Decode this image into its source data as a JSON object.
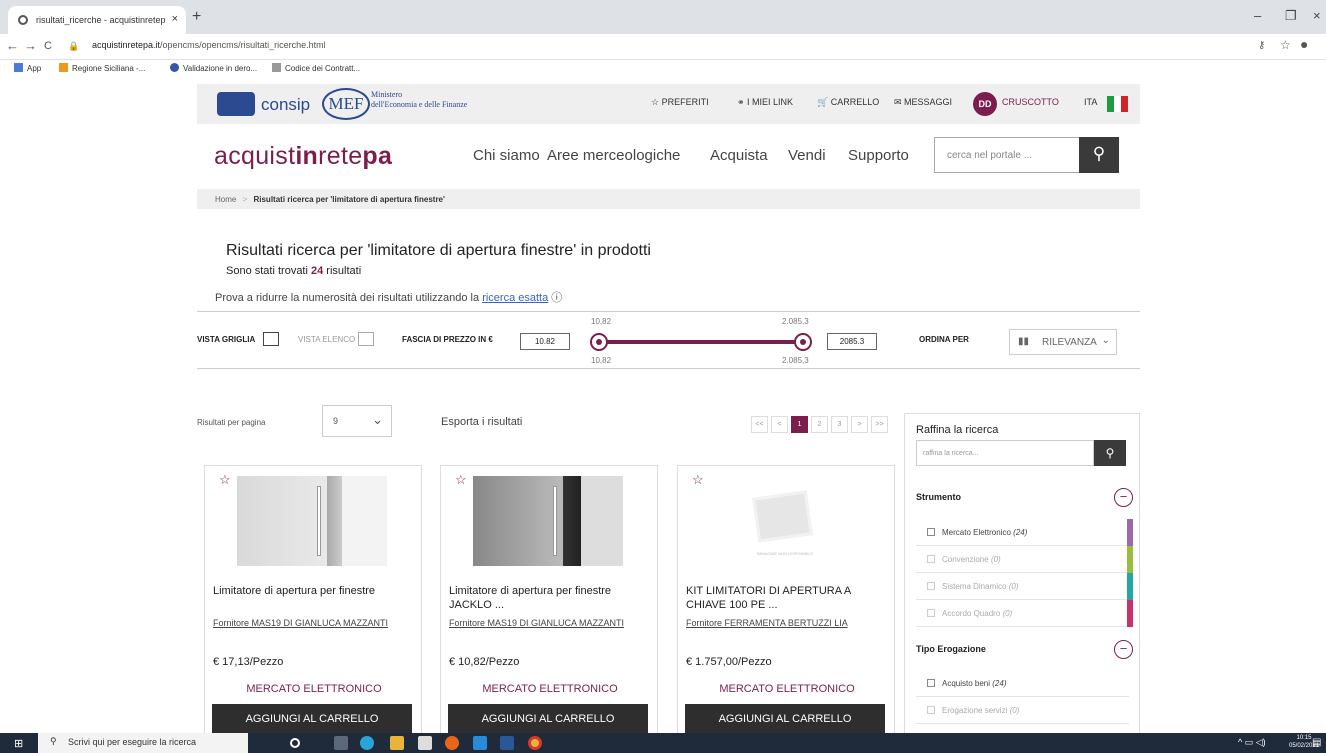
{
  "browser": {
    "tab_title": "risultati_ricerche - acquistinretep",
    "tab_close": "×",
    "new_tab": "+",
    "url_host": "acquistinretepa.it",
    "url_path": "/opencms/opencms/risultati_ricerche.html",
    "back": "←",
    "forward": "→",
    "reload": "C",
    "min": "–",
    "restore": "❐",
    "close": "×"
  },
  "bookmarks": [
    "App",
    "Regione Siciliana -...",
    "Validazione in dero...",
    "Codice dei Contratt..."
  ],
  "topbar": {
    "consip": "consip",
    "mef": "MEF",
    "ministero": "Ministero\ndell'Economia e delle Finanze",
    "preferiti": "PREFERITI",
    "link": "I MIEI LINK",
    "carrello": "CARRELLO",
    "messaggi": "MESSAGGI",
    "avatar": "DD",
    "cruscotto": "CRUSCOTTO",
    "lang": "ITA"
  },
  "nav": {
    "brand_a": "acquist",
    "brand_b": "in",
    "brand_c": "rete",
    "brand_d": "pa",
    "items": [
      "Chi siamo",
      "Aree merceologiche",
      "Acquista",
      "Vendi",
      "Supporto"
    ],
    "search_placeholder": "cerca nel portale ..."
  },
  "breadcrumb": {
    "home": "Home",
    "sep": ">",
    "current": "Risultati ricerca per 'limitatore di apertura finestre'"
  },
  "results": {
    "title": "Risultati ricerca per 'limitatore di apertura finestre' in prodotti",
    "count_pre": "Sono stati trovati ",
    "count": "24",
    "count_post": " risultati",
    "hint": "Prova a ridurre la numerosità dei risultati utilizzando la ",
    "hint_link": "ricerca esatta",
    "hint_icon": "ⓘ"
  },
  "filter": {
    "grid": "VISTA GRIGLIA",
    "list": "VISTA ELENCO",
    "price_label": "FASCIA DI PREZZO IN €",
    "min": "10.82",
    "max": "2085.3",
    "min_lbl": "10,82",
    "max_lbl": "2.085,3",
    "order_label": "ORDINA PER",
    "order_value": "RILEVANZA"
  },
  "paging": {
    "per_page_label": "Risultati per pagina",
    "per_page": "9",
    "export": "Esporta i risultati",
    "pages": [
      "<<",
      "<",
      "1",
      "2",
      "3",
      ">",
      ">>"
    ],
    "current": "1"
  },
  "products": [
    {
      "title": "Limitatore di apertura per finestre",
      "supplier": "Fornitore MAS19 DI GIANLUCA MAZZANTI",
      "price": "€ 17,13/Pezzo",
      "market": "MERCATO ELETTRONICO",
      "cta": "AGGIUNGI AL CARRELLO"
    },
    {
      "title": "Limitatore di apertura per finestre JACKLO ...",
      "supplier": "Fornitore MAS19 DI GIANLUCA MAZZANTI",
      "price": "€ 10,82/Pezzo",
      "market": "MERCATO ELETTRONICO",
      "cta": "AGGIUNGI AL CARRELLO"
    },
    {
      "title": "KIT LIMITATORI DI APERTURA A CHIAVE 100 PE ...",
      "supplier": "Fornitore FERRAMENTA BERTUZZI LIA",
      "price": "€ 1.757,00/Pezzo",
      "market": "MERCATO ELETTRONICO",
      "cta": "AGGIUNGI AL CARRELLO",
      "noimg": "IMMAGINE NON DISPONIBILE"
    }
  ],
  "refine": {
    "title": "Raffina la ricerca",
    "placeholder": "raffina la ricerca...",
    "strumento": "Strumento",
    "strumento_opts": [
      {
        "label": "Mercato Elettronico",
        "count": "(24)",
        "color": "#9b6aa8"
      },
      {
        "label": "Convenzione",
        "count": "(0)",
        "color": "#9bbd3c"
      },
      {
        "label": "Sistema Dinamico",
        "count": "(0)",
        "color": "#24a6a6"
      },
      {
        "label": "Accordo Quadro",
        "count": "(0)",
        "color": "#c8306e"
      }
    ],
    "tipo": "Tipo Erogazione",
    "tipo_opts": [
      {
        "label": "Acquisto beni",
        "count": "(24)"
      },
      {
        "label": "Erogazione servizi",
        "count": "(0)"
      }
    ]
  },
  "taskbar": {
    "search": "Scrivi qui per eseguire la ricerca",
    "time": "10:15",
    "date": "05/02/2021"
  }
}
